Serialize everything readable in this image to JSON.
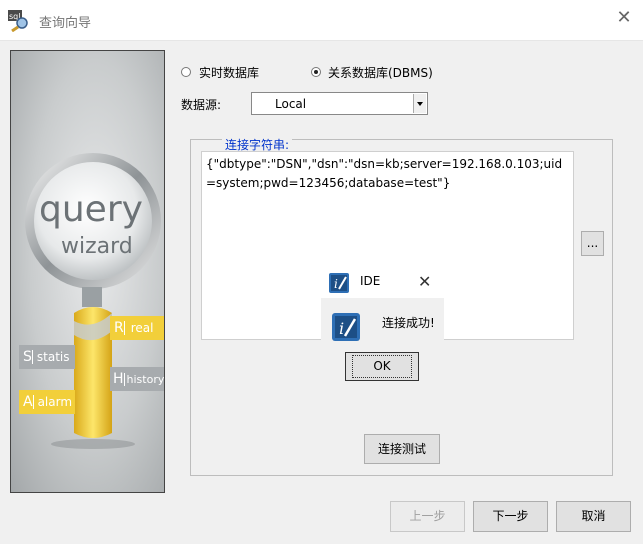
{
  "window": {
    "title": "查询向导"
  },
  "art": {
    "big_word_1": "query",
    "big_word_2": "wizard",
    "tags": [
      {
        "letter": "R",
        "word": "real"
      },
      {
        "letter": "S",
        "word": "statis"
      },
      {
        "letter": "H",
        "word": "history"
      },
      {
        "letter": "A",
        "word": "alarm"
      }
    ]
  },
  "options": {
    "realtime_label": "实时数据库",
    "relational_label": "关系数据库(DBMS)",
    "selected": "relational"
  },
  "datasource": {
    "label": "数据源:",
    "value": "Local"
  },
  "connection": {
    "group_title": "连接字符串:",
    "text": "{\"dbtype\":\"DSN\",\"dsn\":\"dsn=kb;server=192.168.0.103;uid=system;pwd=123456;database=test\"}",
    "browse_label": "...",
    "test_label": "连接测试"
  },
  "message": {
    "title": "IDE",
    "text": "连接成功!",
    "ok_label": "OK"
  },
  "footer": {
    "prev_label": "上一步",
    "next_label": "下一步",
    "cancel_label": "取消"
  },
  "colors": {
    "accent_blue": "#0033cc",
    "tag_yellow": "#f2cf3a",
    "tag_gray": "#a7abae"
  }
}
